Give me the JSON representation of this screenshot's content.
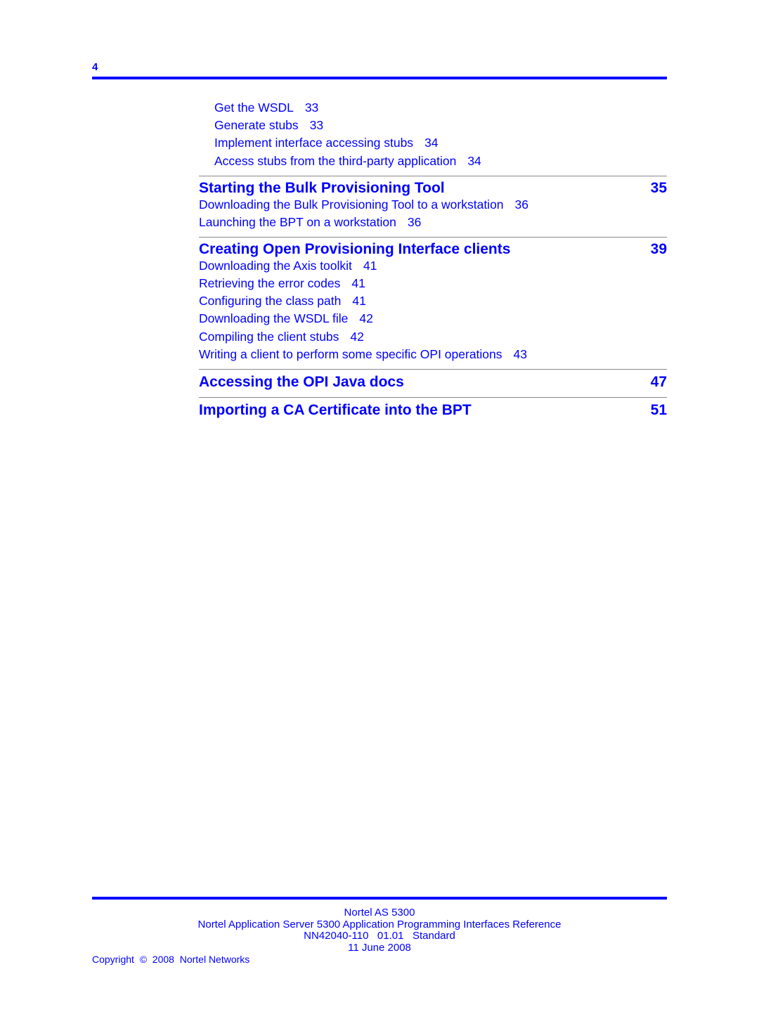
{
  "header": {
    "page_number": "4"
  },
  "toc": {
    "continued_entries": [
      {
        "title": "Get the WSDL",
        "page": "33"
      },
      {
        "title": "Generate stubs",
        "page": "33"
      },
      {
        "title": "Implement interface accessing stubs",
        "page": "34"
      },
      {
        "title": "Access stubs from the third-party application",
        "page": "34"
      }
    ],
    "chapters": [
      {
        "title": "Starting the Bulk Provisioning Tool",
        "page": "35",
        "entries": [
          {
            "title": "Downloading the Bulk Provisioning Tool to a workstation",
            "page": "36"
          },
          {
            "title": "Launching the BPT on a workstation",
            "page": "36"
          }
        ]
      },
      {
        "title": "Creating Open Provisioning Interface clients",
        "page": "39",
        "entries": [
          {
            "title": "Downloading the Axis toolkit",
            "page": "41"
          },
          {
            "title": "Retrieving the error codes",
            "page": "41"
          },
          {
            "title": "Configuring the class path",
            "page": "41"
          },
          {
            "title": "Downloading the WSDL file",
            "page": "42"
          },
          {
            "title": "Compiling the client stubs",
            "page": "42"
          },
          {
            "title": "Writing a client to perform some specific OPI operations",
            "page": "43"
          }
        ]
      },
      {
        "title": "Accessing the OPI Java docs",
        "page": "47",
        "entries": []
      },
      {
        "title": "Importing a CA Certificate into the BPT",
        "page": "51",
        "entries": []
      }
    ]
  },
  "footer": {
    "product": "Nortel AS 5300",
    "document_title": "Nortel Application Server 5300 Application Programming Interfaces Reference",
    "document_id": "NN42040-110   01.01   Standard",
    "date": "11 June 2008",
    "copyright": "Copyright  ©  2008  Nortel Networks"
  },
  "colors": {
    "link": "#0000ff",
    "rule": "#888888"
  }
}
